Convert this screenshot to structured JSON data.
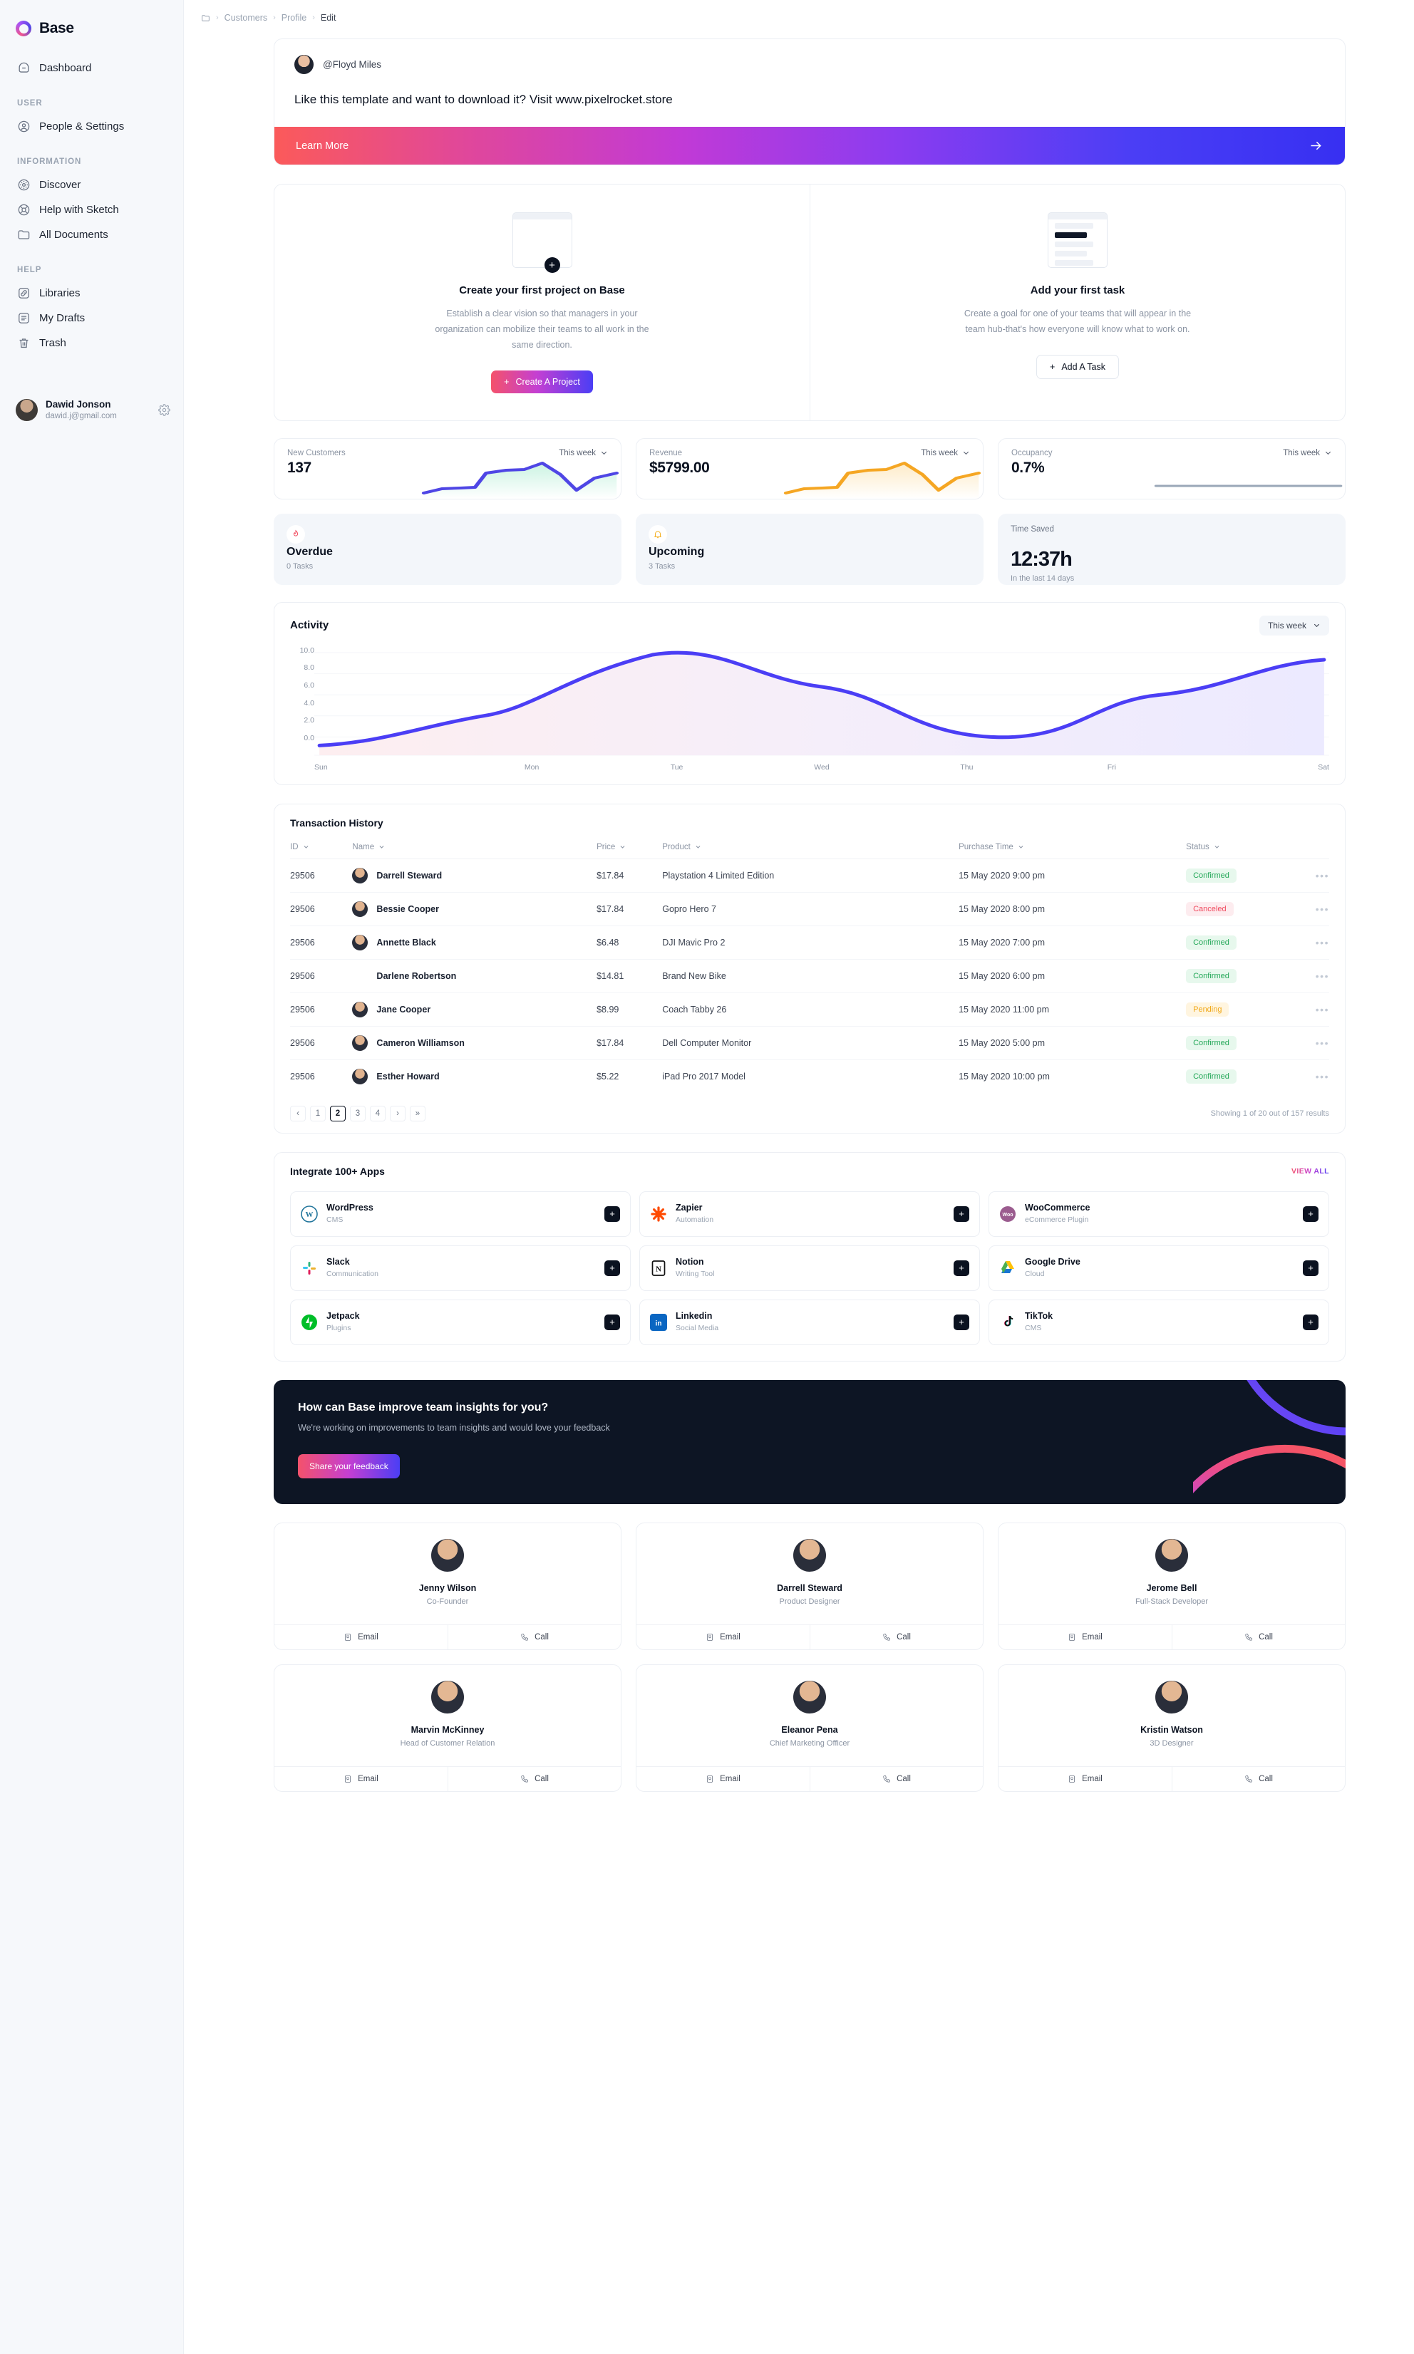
{
  "sidebar": {
    "brand": "Base",
    "primary": [
      {
        "label": "Dashboard",
        "icon": "dashboard-icon"
      }
    ],
    "groups": [
      {
        "label": "USER",
        "items": [
          {
            "label": "People & Settings",
            "icon": "user-circle-icon"
          }
        ]
      },
      {
        "label": "INFORMATION",
        "items": [
          {
            "label": "Discover",
            "icon": "compass-icon"
          },
          {
            "label": "Help with Sketch",
            "icon": "lifebuoy-icon"
          },
          {
            "label": "All Documents",
            "icon": "folder-icon"
          }
        ]
      },
      {
        "label": "HELP",
        "items": [
          {
            "label": "Libraries",
            "icon": "link-icon"
          },
          {
            "label": "My Drafts",
            "icon": "list-icon"
          },
          {
            "label": "Trash",
            "icon": "trash-icon"
          }
        ]
      }
    ],
    "user": {
      "name": "Dawid Jonson",
      "email": "dawid.j@gmail.com",
      "settings_icon": "gear-icon"
    }
  },
  "breadcrumb": {
    "icon": "folder-icon",
    "items": [
      "Customers",
      "Profile",
      "Edit"
    ],
    "separator": "›"
  },
  "promo": {
    "handle": "@Floyd Miles",
    "message": "Like this template and want to download it? Visit www.pixelrocket.store",
    "cta_label": "Learn More",
    "cta_icon": "arrow-right-icon"
  },
  "onboarding": [
    {
      "title": "Create your first project on Base",
      "desc": "Establish a clear vision so that managers in your organization can mobilize their teams to all work in the same direction.",
      "button": "Create A Project",
      "button_icon": "plus-icon",
      "style": "gradient"
    },
    {
      "title": "Add your first task",
      "desc": "Create a goal for one of your teams that will appear in the team hub-that's how everyone will know what to work on.",
      "button": "Add A Task",
      "button_icon": "plus-icon",
      "style": "ghost"
    }
  ],
  "stats": [
    {
      "label": "New Customers",
      "value": "137",
      "range": "This week",
      "accent": "#4f46e5"
    },
    {
      "label": "Revenue",
      "value": "$5799.00",
      "range": "This week",
      "accent": "#f5a623"
    },
    {
      "label": "Occupancy",
      "value": "0.7%",
      "range": "This week",
      "accent": "#9aa7b8"
    }
  ],
  "tasks": [
    {
      "title": "Overdue",
      "sub": "0 Tasks",
      "icon": "flame-icon",
      "color": "#f04a5e"
    },
    {
      "title": "Upcoming",
      "sub": "3 Tasks",
      "icon": "bell-icon",
      "color": "#f5b124"
    }
  ],
  "time_saved": {
    "label": "Time Saved",
    "value": "12:37h",
    "sub": "In the last 14 days"
  },
  "activity": {
    "title": "Activity",
    "range": "This week"
  },
  "chart_data": [
    {
      "type": "area",
      "title": "Activity",
      "xlabel": "",
      "ylabel": "",
      "categories": [
        "Sun",
        "Mon",
        "Tue",
        "Wed",
        "Thu",
        "Fri",
        "Sat"
      ],
      "values": [
        1.0,
        5.0,
        10.0,
        8.0,
        3.0,
        6.0,
        9.0
      ],
      "ytick_labels": [
        "0.0",
        "2.0",
        "4.0",
        "6.0",
        "8.0",
        "10.0"
      ],
      "ylim": [
        0,
        10
      ],
      "grid": true,
      "legend": "none",
      "line_color": "#4b3ef5",
      "fill": "pink-to-lavender gradient"
    },
    {
      "type": "line",
      "title": "New Customers",
      "values": [
        1.0,
        1.4,
        1.5,
        1.6,
        4.2,
        5.0,
        5.1,
        6.2,
        4.6,
        1.8,
        3.4,
        4.0
      ],
      "categories": [],
      "ylim": [
        0,
        7
      ],
      "grid": false,
      "legend": "none",
      "line_color": "#4f46e5"
    },
    {
      "type": "line",
      "title": "Revenue",
      "values": [
        1.0,
        1.4,
        1.5,
        1.6,
        4.2,
        5.0,
        5.1,
        6.2,
        4.6,
        1.8,
        3.4,
        4.0
      ],
      "categories": [],
      "ylim": [
        0,
        7
      ],
      "grid": false,
      "legend": "none",
      "line_color": "#f5a623"
    },
    {
      "type": "line",
      "title": "Occupancy",
      "values": [
        0.7,
        0.7,
        0.7,
        0.7,
        0.7,
        0.7
      ],
      "categories": [],
      "ylim": [
        0,
        10
      ],
      "grid": false,
      "legend": "none",
      "line_color": "#9aa7b8"
    }
  ],
  "transactions": {
    "title": "Transaction History",
    "columns": [
      "ID",
      "Name",
      "Price",
      "Product",
      "Purchase Time",
      "Status"
    ],
    "rows": [
      {
        "id": "29506",
        "name": "Darrell Steward",
        "price": "$17.84",
        "product": "Playstation 4 Limited Edition",
        "time": "15 May 2020 9:00 pm",
        "status": "Confirmed",
        "status_kind": "confirmed",
        "has_avatar": true
      },
      {
        "id": "29506",
        "name": "Bessie Cooper",
        "price": "$17.84",
        "product": "Gopro Hero 7",
        "time": "15 May 2020 8:00 pm",
        "status": "Canceled",
        "status_kind": "canceled",
        "has_avatar": true
      },
      {
        "id": "29506",
        "name": "Annette Black",
        "price": "$6.48",
        "product": "DJI Mavic Pro 2",
        "time": "15 May 2020 7:00 pm",
        "status": "Confirmed",
        "status_kind": "confirmed",
        "has_avatar": true
      },
      {
        "id": "29506",
        "name": "Darlene Robertson",
        "price": "$14.81",
        "product": "Brand New Bike",
        "time": "15 May 2020 6:00 pm",
        "status": "Confirmed",
        "status_kind": "confirmed",
        "has_avatar": false
      },
      {
        "id": "29506",
        "name": "Jane Cooper",
        "price": "$8.99",
        "product": "Coach Tabby 26",
        "time": "15 May 2020 11:00 pm",
        "status": "Pending",
        "status_kind": "pending",
        "has_avatar": true
      },
      {
        "id": "29506",
        "name": "Cameron Williamson",
        "price": "$17.84",
        "product": "Dell Computer Monitor",
        "time": "15 May 2020 5:00 pm",
        "status": "Confirmed",
        "status_kind": "confirmed",
        "has_avatar": true
      },
      {
        "id": "29506",
        "name": "Esther Howard",
        "price": "$5.22",
        "product": "iPad Pro 2017 Model",
        "time": "15 May 2020 10:00 pm",
        "status": "Confirmed",
        "status_kind": "confirmed",
        "has_avatar": true
      }
    ],
    "pagination": {
      "pages": [
        "1",
        "2",
        "3",
        "4"
      ],
      "active": "2",
      "prev": "‹",
      "next": "›",
      "last": "»",
      "info": "Showing 1 of 20 out of 157 results"
    }
  },
  "integrations": {
    "title": "Integrate 100+ Apps",
    "view_all": "VIEW ALL",
    "add_icon": "plus-icon",
    "apps": [
      {
        "name": "WordPress",
        "category": "CMS",
        "logo": "wordpress-icon"
      },
      {
        "name": "Zapier",
        "category": "Automation",
        "logo": "zapier-icon"
      },
      {
        "name": "WooCommerce",
        "category": "eCommerce Plugin",
        "logo": "woocommerce-icon"
      },
      {
        "name": "Slack",
        "category": "Communication",
        "logo": "slack-icon"
      },
      {
        "name": "Notion",
        "category": "Writing Tool",
        "logo": "notion-icon"
      },
      {
        "name": "Google Drive",
        "category": "Cloud",
        "logo": "google-drive-icon"
      },
      {
        "name": "Jetpack",
        "category": "Plugins",
        "logo": "jetpack-icon"
      },
      {
        "name": "Linkedin",
        "category": "Social Media",
        "logo": "linkedin-icon"
      },
      {
        "name": "TikTok",
        "category": "CMS",
        "logo": "tiktok-icon"
      }
    ]
  },
  "feedback": {
    "title": "How can Base improve team insights for you?",
    "subtitle": "We're working on improvements to team insights and would love your feedback",
    "button": "Share your feedback"
  },
  "team": {
    "email_label": "Email",
    "call_label": "Call",
    "members": [
      {
        "name": "Jenny Wilson",
        "role": "Co-Founder"
      },
      {
        "name": "Darrell Steward",
        "role": "Product Designer"
      },
      {
        "name": "Jerome Bell",
        "role": "Full-Stack Developer"
      },
      {
        "name": "Marvin McKinney",
        "role": "Head of Customer Relation"
      },
      {
        "name": "Eleanor Pena",
        "role": "Chief Marketing Officer"
      },
      {
        "name": "Kristin Watson",
        "role": "3D Designer"
      }
    ]
  }
}
